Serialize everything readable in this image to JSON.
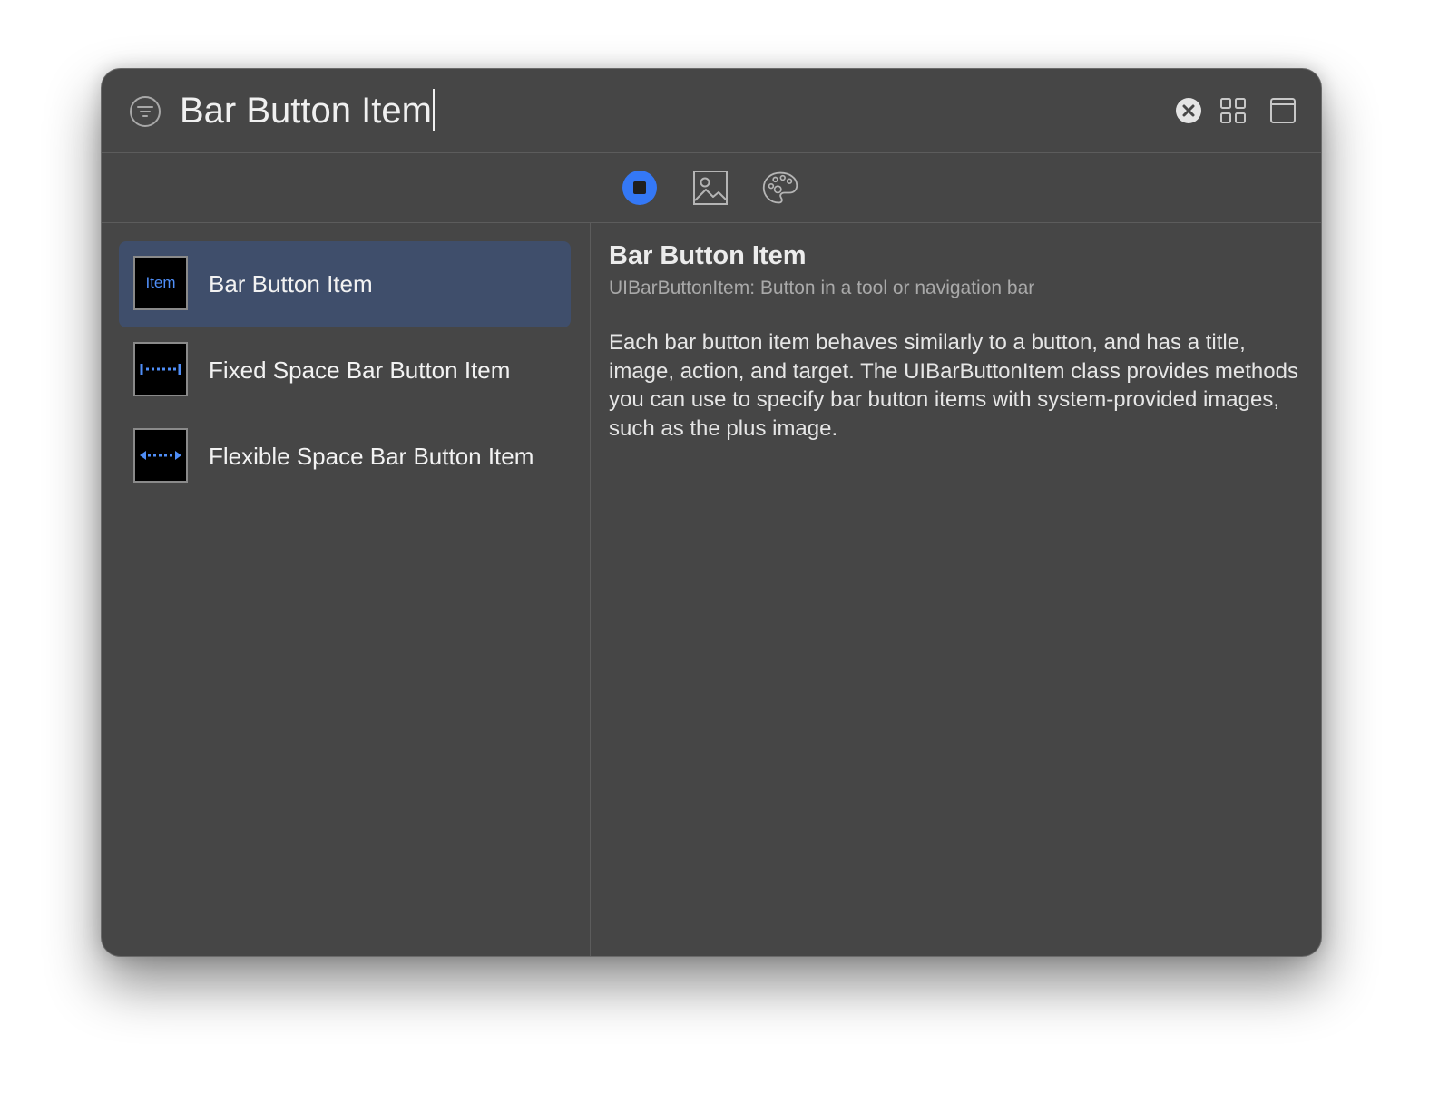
{
  "search": {
    "value": "Bar Button Item"
  },
  "icons": {
    "filter": "filter-icon",
    "clear": "clear-icon",
    "grid": "grid-view-icon",
    "window": "window-icon",
    "objects": "objects-library-icon",
    "media": "media-library-icon",
    "colors": "color-palette-icon"
  },
  "colors": {
    "accent": "#3478f6",
    "selection": "#3f4e6b",
    "window_bg": "#464646"
  },
  "results": [
    {
      "label": "Bar Button Item",
      "thumb_text": "Item",
      "selected": true
    },
    {
      "label": "Fixed Space Bar Button Item",
      "thumb_text": "",
      "selected": false
    },
    {
      "label": "Flexible Space Bar Button Item",
      "thumb_text": "",
      "selected": false
    }
  ],
  "detail": {
    "title": "Bar Button Item",
    "subtitle": "UIBarButtonItem: Button in a tool or navigation bar",
    "description": "Each bar button item behaves similarly to a button, and has a title, image, action, and target. The UIBarButtonItem class provides methods you can use to specify bar button items with system-provided images, such as the plus image."
  }
}
